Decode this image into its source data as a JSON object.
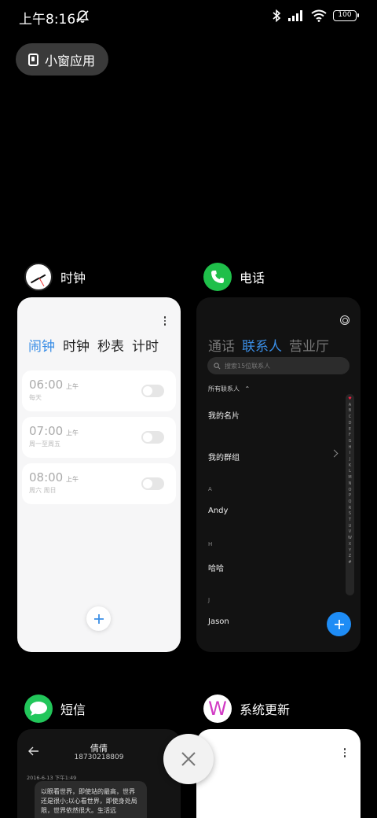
{
  "status_bar": {
    "time": "上午8:16",
    "battery": "100",
    "icons": [
      "mute-icon",
      "bluetooth-icon",
      "signal-icon",
      "wifi-icon",
      "battery-icon"
    ]
  },
  "small_window_button": {
    "label": "小窗应用",
    "icon": "small-window-icon"
  },
  "apps": {
    "clock": {
      "title": "时钟",
      "tabs": [
        "闹钟",
        "时钟",
        "秒表",
        "计时"
      ],
      "active_tab": "闹钟",
      "alarms": [
        {
          "time": "06:00",
          "ampm": "上午",
          "repeat": "每天",
          "enabled": false
        },
        {
          "time": "07:00",
          "ampm": "上午",
          "repeat": "周一至周五",
          "enabled": false
        },
        {
          "time": "08:00",
          "ampm": "上午",
          "repeat": "周六 周日",
          "enabled": false
        }
      ]
    },
    "phone": {
      "title": "电话",
      "tabs": [
        "通话",
        "联系人",
        "营业厅"
      ],
      "active_tab": "联系人",
      "search_placeholder": "搜索15位联系人",
      "group_filter": "所有联系人",
      "items": {
        "my_card": "我的名片",
        "my_groups": "我的群组",
        "letter_a": "A",
        "contact_andy": "Andy",
        "letter_h": "H",
        "contact_haha": "哈哈",
        "letter_j": "J",
        "contact_jason": "Jason"
      },
      "alpha_index": [
        "♥",
        "A",
        "B",
        "C",
        "D",
        "E",
        "F",
        "G",
        "H",
        "I",
        "J",
        "K",
        "L",
        "M",
        "N",
        "O",
        "P",
        "Q",
        "R",
        "S",
        "T",
        "U",
        "V",
        "W",
        "X",
        "Y",
        "Z",
        "#"
      ]
    },
    "sms": {
      "title": "短信",
      "contact_name": "倩倩",
      "contact_number": "18730218809",
      "date": "2016-6-13 下午1:49",
      "message": "以眼看世界，即使站的最高，世界还是很小;以心看世界，即使身处局限，世界依然很大。生活远"
    },
    "update": {
      "title": "系统更新",
      "icon_letter": "W"
    }
  },
  "colors": {
    "accent_blue": "#3a8ee6",
    "phone_green": "#1fbf4a",
    "fab_blue": "#1e8cf5"
  }
}
